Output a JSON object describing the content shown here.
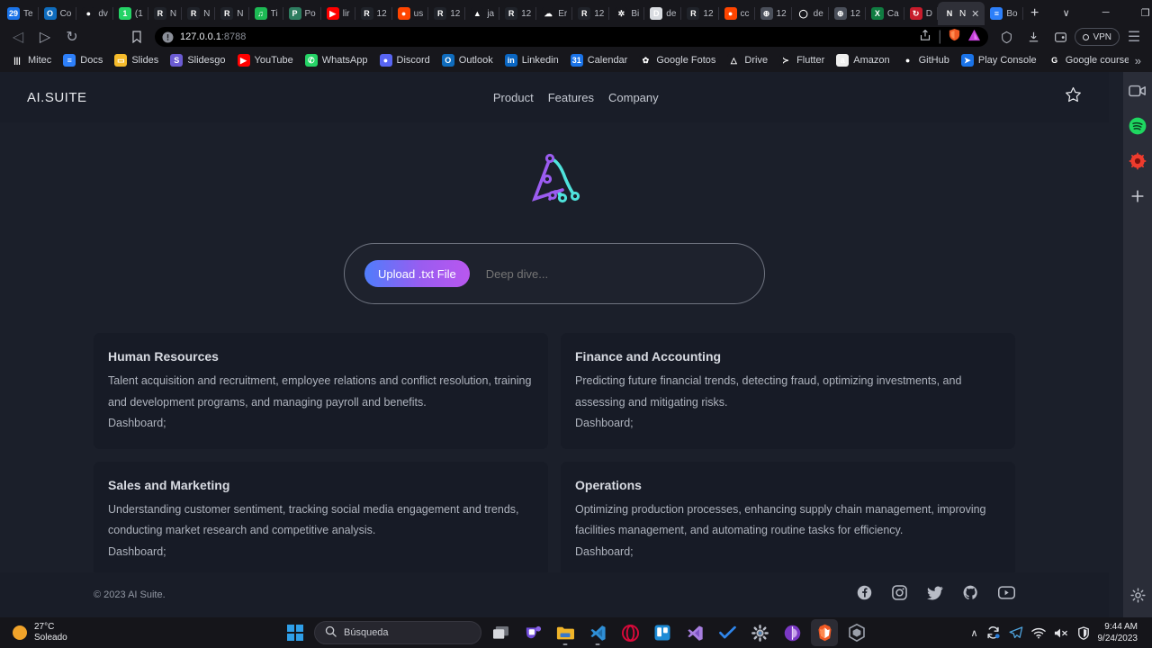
{
  "browser": {
    "tabs": [
      {
        "label": "Te",
        "icon": "calendar-icon",
        "color": "#1a73e8",
        "glyph": "29",
        "active": false
      },
      {
        "label": "Co",
        "icon": "outlook-icon",
        "color": "#0f6cbd",
        "glyph": "O",
        "active": false
      },
      {
        "label": "dv",
        "icon": "github-icon",
        "color": "#17171c",
        "glyph": "●",
        "active": false
      },
      {
        "label": "(1",
        "icon": "whatsapp-icon",
        "color": "#25d366",
        "glyph": "1",
        "active": false
      },
      {
        "label": "N",
        "icon": "react-icon",
        "color": "#20232a",
        "glyph": "R",
        "active": false
      },
      {
        "label": "N",
        "icon": "react-icon",
        "color": "#20232a",
        "glyph": "R",
        "active": false
      },
      {
        "label": "N",
        "icon": "react-icon",
        "color": "#20232a",
        "glyph": "R",
        "active": false
      },
      {
        "label": "Ti",
        "icon": "spotify-icon",
        "color": "#1db954",
        "glyph": "♫",
        "active": false
      },
      {
        "label": "Po",
        "icon": "pinterest-icon",
        "color": "#2e7d60",
        "glyph": "P",
        "active": false
      },
      {
        "label": "lir",
        "icon": "youtube-icon",
        "color": "#ff0000",
        "glyph": "▶",
        "active": false
      },
      {
        "label": "12",
        "icon": "react-icon",
        "color": "#20232a",
        "glyph": "R",
        "active": false
      },
      {
        "label": "us",
        "icon": "reddit-icon",
        "color": "#ff4500",
        "glyph": "●",
        "active": false
      },
      {
        "label": "12",
        "icon": "react-icon",
        "color": "#20232a",
        "glyph": "R",
        "active": false
      },
      {
        "label": "ja",
        "icon": "firebase-icon",
        "color": "#17171c",
        "glyph": "▲",
        "active": false
      },
      {
        "label": "12",
        "icon": "react-icon",
        "color": "#20232a",
        "glyph": "R",
        "active": false
      },
      {
        "label": "Er",
        "icon": "cloud-icon",
        "color": "#17171c",
        "glyph": "☁",
        "active": false
      },
      {
        "label": "12",
        "icon": "react-icon",
        "color": "#20232a",
        "glyph": "R",
        "active": false
      },
      {
        "label": "Bi",
        "icon": "openai-icon",
        "color": "#17171c",
        "glyph": "✲",
        "active": false
      },
      {
        "label": "de",
        "icon": "docker-icon",
        "color": "#d9dce1",
        "glyph": "D",
        "active": false
      },
      {
        "label": "12",
        "icon": "react-icon",
        "color": "#20232a",
        "glyph": "R",
        "active": false
      },
      {
        "label": "cc",
        "icon": "reddit-icon",
        "color": "#ff4500",
        "glyph": "●",
        "active": false
      },
      {
        "label": "12",
        "icon": "globe-icon",
        "color": "#4a4f5a",
        "glyph": "⊕",
        "active": false
      },
      {
        "label": "de",
        "icon": "circle-icon",
        "color": "#17171c",
        "glyph": "◯",
        "active": false
      },
      {
        "label": "12",
        "icon": "globe-icon",
        "color": "#4a4f5a",
        "glyph": "⊕",
        "active": false
      },
      {
        "label": "Ca",
        "icon": "excel-icon",
        "color": "#107c41",
        "glyph": "X",
        "active": false
      },
      {
        "label": "D",
        "icon": "nodejs-red-icon",
        "color": "#c71c2c",
        "glyph": "↻",
        "active": false
      },
      {
        "label": "N",
        "icon": "netlify-icon",
        "color": "#2f3038",
        "glyph": "N",
        "active": true,
        "close": "✕"
      },
      {
        "label": "Bo",
        "icon": "docs-icon",
        "color": "#2d7ff9",
        "glyph": "≡",
        "active": false
      }
    ],
    "new_tab_label": "+",
    "window_controls": {
      "tab_search": "∨",
      "minimize": "─",
      "maximize": "❐",
      "close": "✕"
    },
    "nav": {
      "back": "◁",
      "forward": "▷",
      "reload": "↻",
      "bookmark_flag": "⚑",
      "url_text": "127.0.0.1",
      "url_port": ":8788",
      "site_info_icon": "info-icon",
      "share_icon": "⤴",
      "brave_shields": "brave-shields-icon",
      "extension_icon": "extension-triangle-icon",
      "wallet_icon": "⬡",
      "downloads_icon": "⬇",
      "profile_icon": "▢",
      "vpn_label": "VPN",
      "menu_icon": "☰"
    },
    "bookmarks": [
      {
        "label": "Mitec",
        "icon": "mitec-icon",
        "color": "#17171c",
        "glyph": "|||"
      },
      {
        "label": "Docs",
        "icon": "google-docs-icon",
        "color": "#2d7ff9",
        "glyph": "≡"
      },
      {
        "label": "Slides",
        "icon": "google-slides-icon",
        "color": "#f5bb2b",
        "glyph": "▭"
      },
      {
        "label": "Slidesgo",
        "icon": "slidesgo-icon",
        "color": "#6b5bd2",
        "glyph": "S"
      },
      {
        "label": "YouTube",
        "icon": "youtube-icon",
        "color": "#ff0000",
        "glyph": "▶"
      },
      {
        "label": "WhatsApp",
        "icon": "whatsapp-icon",
        "color": "#25d366",
        "glyph": "✆"
      },
      {
        "label": "Discord",
        "icon": "discord-icon",
        "color": "#5865f2",
        "glyph": "●"
      },
      {
        "label": "Outlook",
        "icon": "outlook-icon",
        "color": "#0f6cbd",
        "glyph": "O"
      },
      {
        "label": "Linkedin",
        "icon": "linkedin-icon",
        "color": "#0a66c2",
        "glyph": "in"
      },
      {
        "label": "Calendar",
        "icon": "google-calendar-icon",
        "color": "#1a73e8",
        "glyph": "31"
      },
      {
        "label": "Google Fotos",
        "icon": "google-photos-icon",
        "color": "#17171c",
        "glyph": "✿"
      },
      {
        "label": "Drive",
        "icon": "google-drive-icon",
        "color": "#17171c",
        "glyph": "△"
      },
      {
        "label": "Flutter",
        "icon": "flutter-icon",
        "color": "#17171c",
        "glyph": "≻"
      },
      {
        "label": "Amazon",
        "icon": "amazon-icon",
        "color": "#eeeeee",
        "glyph": "a"
      },
      {
        "label": "GitHub",
        "icon": "github-icon",
        "color": "#17171c",
        "glyph": "●"
      },
      {
        "label": "Play Console",
        "icon": "play-console-icon",
        "color": "#1a73e8",
        "glyph": "➤"
      },
      {
        "label": "Google courses",
        "icon": "google-icon",
        "color": "#17171c",
        "glyph": "G"
      }
    ],
    "bookmarks_overflow": "»",
    "sidebar": [
      {
        "name": "brave-talk-icon",
        "glyph": "video"
      },
      {
        "name": "spotify-icon",
        "glyph": "spotify"
      },
      {
        "name": "brave-leo-icon",
        "glyph": "leo"
      },
      {
        "name": "add-panel-icon",
        "glyph": "+"
      }
    ],
    "sidebar_settings_icon": "gear-icon",
    "scrollbar": {
      "up_arrow": "▲",
      "down_arrow": "▼"
    }
  },
  "site": {
    "brand": "AI.SUITE",
    "nav": [
      {
        "label": "Product"
      },
      {
        "label": "Features"
      },
      {
        "label": "Company"
      }
    ],
    "star_icon": "star-outline-icon",
    "logo_alt": "ai-suite-logo",
    "upload": {
      "button_label": "Upload .txt File",
      "input_value": "",
      "input_placeholder": "Deep dive..."
    },
    "cards": [
      {
        "title": "Human Resources",
        "description": "Talent acquisition and recruitment, employee relations and conflict resolution, training and development programs, and managing payroll and benefits.",
        "dashboard": "Dashboard;"
      },
      {
        "title": "Finance and Accounting",
        "description": "Predicting future financial trends, detecting fraud, optimizing investments, and assessing and mitigating risks.",
        "dashboard": "Dashboard;"
      },
      {
        "title": "Sales and Marketing",
        "description": "Understanding customer sentiment, tracking social media engagement and trends, conducting market research and competitive analysis.",
        "dashboard": "Dashboard;"
      },
      {
        "title": "Operations",
        "description": "Optimizing production processes, enhancing supply chain management, improving facilities management, and automating routine tasks for efficiency.",
        "dashboard": "Dashboard;"
      }
    ],
    "footer": {
      "copyright": "© 2023 AI Suite.",
      "social": [
        {
          "name": "facebook-icon"
        },
        {
          "name": "instagram-icon"
        },
        {
          "name": "twitter-icon"
        },
        {
          "name": "github-icon"
        },
        {
          "name": "youtube-icon"
        }
      ]
    },
    "colors": {
      "page_bg": "#1b1f2a",
      "header_bg": "#191d28",
      "card_bg": "#171b26",
      "accent_purple": "#9b5cf0",
      "accent_blue": "#4f7dfb",
      "accent_cyan": "#4fe3dc"
    }
  },
  "taskbar": {
    "weather": {
      "temperature": "27°C",
      "condition": "Soleado"
    },
    "start_label": "start-button",
    "search_placeholder": "Búsqueda",
    "items": [
      {
        "name": "task-view-icon"
      },
      {
        "name": "teams-icon"
      },
      {
        "name": "file-explorer-icon"
      },
      {
        "name": "vscode-icon"
      },
      {
        "name": "opera-icon"
      },
      {
        "name": "trello-icon"
      },
      {
        "name": "visual-studio-icon"
      },
      {
        "name": "todoist-icon"
      },
      {
        "name": "settings-icon"
      },
      {
        "name": "tor-browser-icon"
      },
      {
        "name": "brave-icon"
      },
      {
        "name": "gitkraken-icon"
      }
    ],
    "tray": {
      "chevron": "∧",
      "icons": [
        "sync-icon",
        "telegram-icon",
        "wifi-icon",
        "volume-muted-icon",
        "bitwarden-icon"
      ]
    },
    "clock": {
      "time": "9:44 AM",
      "date": "9/24/2023"
    }
  }
}
